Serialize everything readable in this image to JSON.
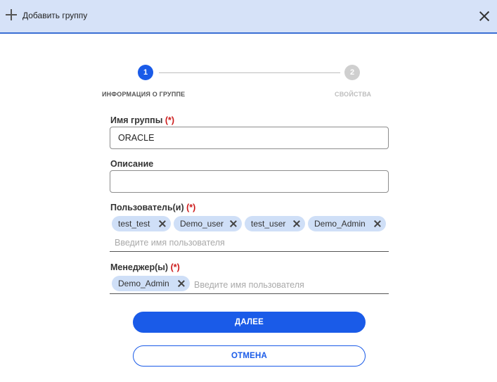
{
  "header": {
    "title": "Добавить группу",
    "icon": "plus-icon",
    "close_icon": "close-icon"
  },
  "stepper": {
    "steps": [
      {
        "number": "1",
        "label": "ИНФОРМАЦИЯ О ГРУППЕ",
        "active": true
      },
      {
        "number": "2",
        "label": "СВОЙСТВА",
        "active": false
      }
    ]
  },
  "form": {
    "group_name": {
      "label": "Имя группы",
      "required_mark": "(*)",
      "value": "ORACLE"
    },
    "description": {
      "label": "Описание",
      "value": ""
    },
    "users": {
      "label": "Пользователь(и)",
      "required_mark": "(*)",
      "chips": [
        "test_test",
        "Demo_user",
        "test_user",
        "Demo_Admin"
      ],
      "placeholder": "Введите имя пользователя"
    },
    "managers": {
      "label": "Менеджер(ы)",
      "required_mark": "(*)",
      "chips": [
        "Demo_Admin"
      ],
      "placeholder": "Введите имя пользователя"
    }
  },
  "buttons": {
    "next_label": "ДАЛЕЕ",
    "cancel_label": "ОТМЕНА"
  },
  "colors": {
    "accent": "#1a5be8",
    "header_bg": "#d6e2f8",
    "chip_bg": "#cfdff7",
    "required": "#cc1a1a"
  }
}
